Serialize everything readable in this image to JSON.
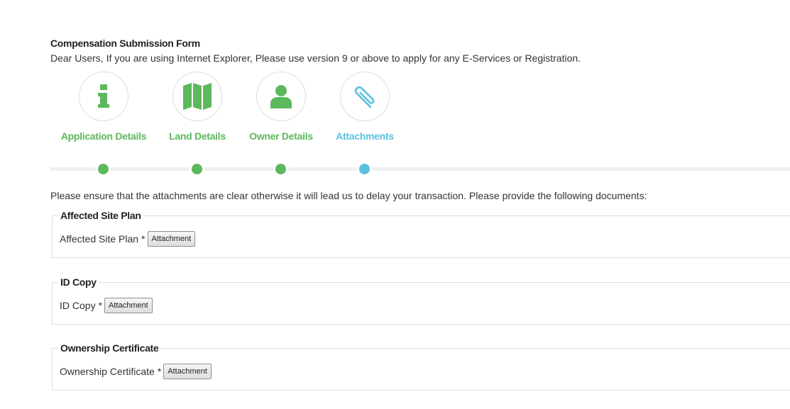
{
  "form": {
    "title": "Compensation Submission Form",
    "notice": "Dear Users, If you are using Internet Explorer, Please use version 9 or above to apply for any E-Services or Registration."
  },
  "colors": {
    "complete": "#5cb85c",
    "active": "#5bc0de"
  },
  "steps": [
    {
      "label": "Application Details",
      "icon": "info-icon",
      "state": "complete"
    },
    {
      "label": "Land Details",
      "icon": "map-icon",
      "state": "complete"
    },
    {
      "label": "Owner Details",
      "icon": "user-icon",
      "state": "complete"
    },
    {
      "label": "Attachments",
      "icon": "paperclip-icon",
      "state": "active"
    }
  ],
  "instructions": "Please ensure that the attachments are clear otherwise it will lead us to delay your transaction. Please provide the following documents:",
  "documents": [
    {
      "legend": "Affected Site Plan",
      "label": "Affected Site Plan",
      "required": "*",
      "button": "Attachment"
    },
    {
      "legend": "ID Copy",
      "label": "ID Copy",
      "required": "*",
      "button": "Attachment"
    },
    {
      "legend": "Ownership Certificate",
      "label": "Ownership Certificate",
      "required": "*",
      "button": "Attachment"
    }
  ]
}
